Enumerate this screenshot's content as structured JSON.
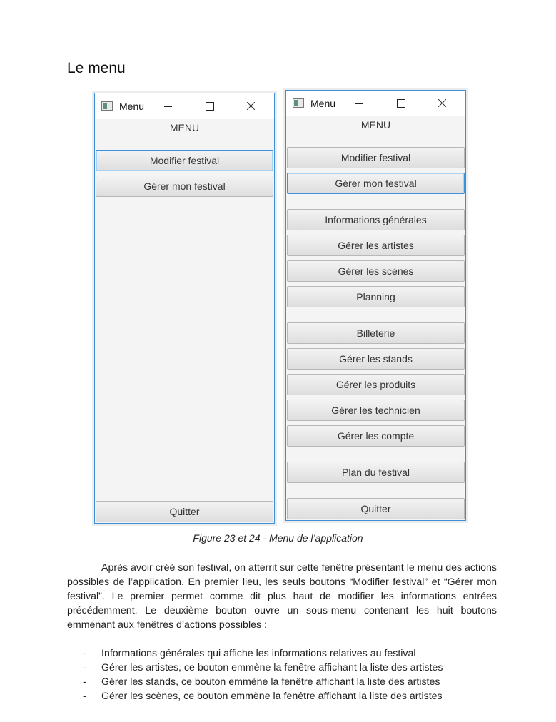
{
  "heading": "Le menu",
  "window_left": {
    "title": "Menu",
    "menu_label": "MENU",
    "buttons": [
      "Modifier festival",
      "Gérer mon festival"
    ],
    "quit_label": "Quitter"
  },
  "window_right": {
    "title": "Menu",
    "menu_label": "MENU",
    "buttons": [
      "Modifier festival",
      "Gérer mon festival"
    ],
    "group1": [
      "Informations générales",
      "Gérer les artistes",
      "Gérer les scènes",
      "Planning"
    ],
    "group2": [
      "Billeterie",
      "Gérer les stands",
      "Gérer les produits",
      "Gérer les technicien",
      "Gérer les compte"
    ],
    "group3": [
      "Plan du festival"
    ],
    "quit_label": "Quitter"
  },
  "caption": "Figure 23 et 24  - Menu de l’application",
  "paragraph": "Après avoir créé son festival, on atterrit sur cette fenêtre présentant le menu des actions possibles de l’application. En premier lieu, les seuls boutons “Modifier festival” et “Gérer mon festival”. Le premier permet comme dit plus haut de modifier les informations entrées précédemment. Le deuxième bouton ouvre un sous-menu contenant les huit boutons emmenant aux fenêtres d’actions possibles :",
  "bullet_marker": "-",
  "bullets": [
    "Informations générales qui affiche les informations relatives au festival",
    "Gérer les artistes, ce bouton emmène la fenêtre affichant la liste des artistes",
    "Gérer les stands, ce bouton emmène la fenêtre affichant la liste des artistes",
    "Gérer les scènes, ce bouton emmène la fenêtre affichant la liste des artistes"
  ]
}
